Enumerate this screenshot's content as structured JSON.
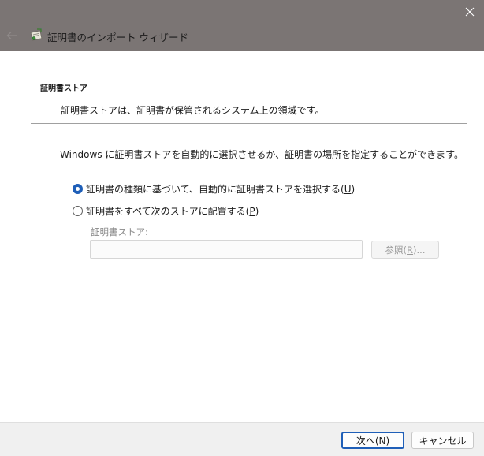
{
  "window": {
    "close_tooltip_icon": "close-icon",
    "back_icon": "back-arrow-icon",
    "title_icon": "certificate-wizard-icon",
    "title": "証明書のインポート ウィザード"
  },
  "section": {
    "title": "証明書ストア",
    "description": "証明書ストアは、証明書が保管されるシステム上の領域です。"
  },
  "instruction": "Windows に証明書ストアを自動的に選択させるか、証明書の場所を指定することができます。",
  "options": [
    {
      "label": "証明書の種類に基づいて、自動的に証明書ストアを選択する(",
      "mnemonic": "U",
      "suffix": ")",
      "checked": true
    },
    {
      "label": "証明書をすべて次のストアに配置する(",
      "mnemonic": "P",
      "suffix": ")",
      "checked": false
    }
  ],
  "store": {
    "label": "証明書ストア:",
    "value": "",
    "browse_label": "参照(",
    "browse_mnemonic": "R",
    "browse_suffix": ")..."
  },
  "footer": {
    "next_label": "次へ(N)",
    "cancel_label": "キャンセル"
  },
  "colors": {
    "header_bg": "#7b7574",
    "accent": "#1f5fb8",
    "footer_bg": "#f0f0f0"
  }
}
